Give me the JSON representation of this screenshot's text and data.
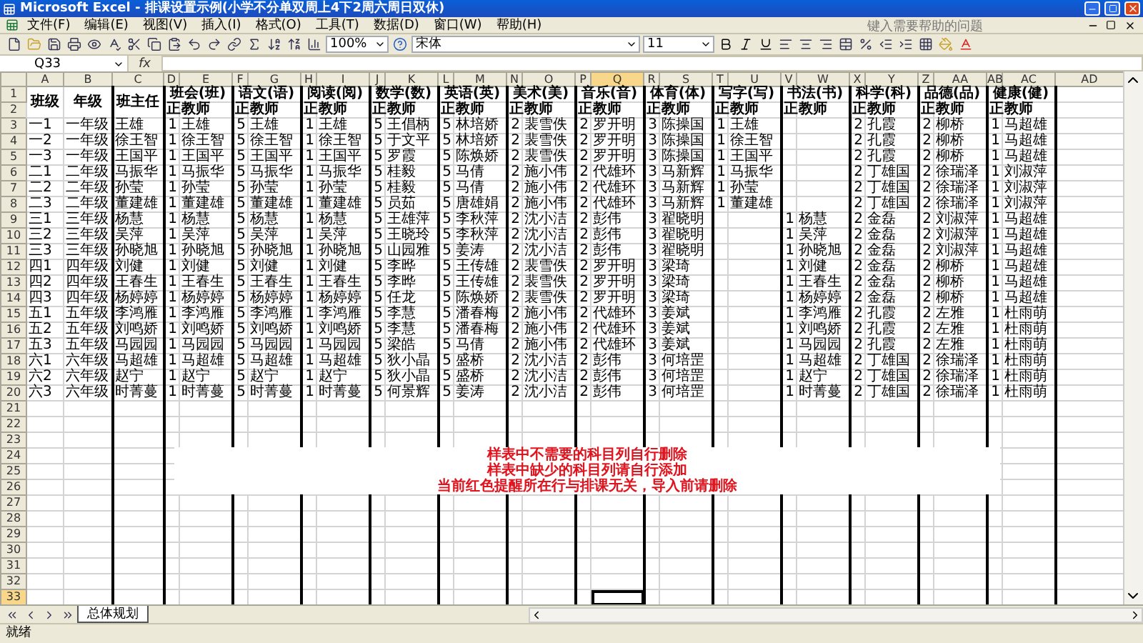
{
  "window": {
    "title": "Microsoft Excel - 排课设置示例(小学不分单双周上4下2周六周日双休)"
  },
  "menu": [
    "文件(F)",
    "编辑(E)",
    "视图(V)",
    "插入(I)",
    "格式(O)",
    "工具(T)",
    "数据(D)",
    "窗口(W)",
    "帮助(H)"
  ],
  "help_search": {
    "placeholder": "键入需要帮助的问题"
  },
  "toolbar": {
    "zoom": "100%",
    "font": "宋体",
    "size": "11"
  },
  "formula_bar": {
    "name_box": "Q33",
    "fx": "fx"
  },
  "column_headers": [
    {
      "label": "A",
      "selected": false
    },
    {
      "label": "B",
      "selected": false
    },
    {
      "label": "C",
      "selected": false
    },
    {
      "label": "D",
      "selected": false
    },
    {
      "label": "E",
      "selected": false
    },
    {
      "label": "F",
      "selected": false
    },
    {
      "label": "G",
      "selected": false
    },
    {
      "label": "H",
      "selected": false
    },
    {
      "label": "I",
      "selected": false
    },
    {
      "label": "J",
      "selected": false
    },
    {
      "label": "K",
      "selected": false
    },
    {
      "label": "L",
      "selected": false
    },
    {
      "label": "M",
      "selected": false
    },
    {
      "label": "N",
      "selected": false
    },
    {
      "label": "O",
      "selected": false
    },
    {
      "label": "P",
      "selected": false
    },
    {
      "label": "Q",
      "selected": true
    },
    {
      "label": "R",
      "selected": false
    },
    {
      "label": "S",
      "selected": false
    },
    {
      "label": "T",
      "selected": false
    },
    {
      "label": "U",
      "selected": false
    },
    {
      "label": "V",
      "selected": false
    },
    {
      "label": "W",
      "selected": false
    },
    {
      "label": "X",
      "selected": false
    },
    {
      "label": "Y",
      "selected": false
    },
    {
      "label": "Z",
      "selected": false
    },
    {
      "label": "AA",
      "selected": false
    },
    {
      "label": "AB",
      "selected": false
    },
    {
      "label": "AC",
      "selected": false
    },
    {
      "label": "AD",
      "selected": false
    }
  ],
  "row_numbers": [
    {
      "label": "1",
      "selected": false
    },
    {
      "label": "2",
      "selected": false
    },
    {
      "label": "3",
      "selected": false
    },
    {
      "label": "4",
      "selected": false
    },
    {
      "label": "5",
      "selected": false
    },
    {
      "label": "6",
      "selected": false
    },
    {
      "label": "7",
      "selected": false
    },
    {
      "label": "8",
      "selected": false
    },
    {
      "label": "9",
      "selected": false
    },
    {
      "label": "10",
      "selected": false
    },
    {
      "label": "11",
      "selected": false
    },
    {
      "label": "12",
      "selected": false
    },
    {
      "label": "13",
      "selected": false
    },
    {
      "label": "14",
      "selected": false
    },
    {
      "label": "15",
      "selected": false
    },
    {
      "label": "16",
      "selected": false
    },
    {
      "label": "17",
      "selected": false
    },
    {
      "label": "18",
      "selected": false
    },
    {
      "label": "19",
      "selected": false
    },
    {
      "label": "20",
      "selected": false
    },
    {
      "label": "21",
      "selected": false
    },
    {
      "label": "22",
      "selected": false
    },
    {
      "label": "23",
      "selected": false
    },
    {
      "label": "24",
      "selected": false
    },
    {
      "label": "25",
      "selected": false
    },
    {
      "label": "26",
      "selected": false
    },
    {
      "label": "27",
      "selected": false
    },
    {
      "label": "28",
      "selected": false
    },
    {
      "label": "29",
      "selected": false
    },
    {
      "label": "30",
      "selected": false
    },
    {
      "label": "31",
      "selected": false
    },
    {
      "label": "32",
      "selected": false
    },
    {
      "label": "33",
      "selected": true
    }
  ],
  "table": {
    "header_labels": [
      "班级",
      "年级",
      "班主任"
    ],
    "subjects": [
      {
        "name": "班会(班)",
        "count_label": "正",
        "teacher_label": "教师"
      },
      {
        "name": "语文(语)",
        "count_label": "正",
        "teacher_label": "教师"
      },
      {
        "name": "阅读(阅)",
        "count_label": "正",
        "teacher_label": "教师"
      },
      {
        "name": "数学(数)",
        "count_label": "正",
        "teacher_label": "教师"
      },
      {
        "name": "英语(英)",
        "count_label": "正",
        "teacher_label": "教师"
      },
      {
        "name": "美术(美)",
        "count_label": "正",
        "teacher_label": "教师"
      },
      {
        "name": "音乐(音)",
        "count_label": "正",
        "teacher_label": "教师"
      },
      {
        "name": "体育(体)",
        "count_label": "正",
        "teacher_label": "教师"
      },
      {
        "name": "写字(写)",
        "count_label": "正",
        "teacher_label": "教师"
      },
      {
        "name": "书法(书)",
        "count_label": "正",
        "teacher_label": "教师"
      },
      {
        "name": "科学(科)",
        "count_label": "正",
        "teacher_label": "教师"
      },
      {
        "name": "品德(品)",
        "count_label": "正",
        "teacher_label": "教师"
      },
      {
        "name": "健康(健)",
        "count_label": "正",
        "teacher_label": "教师"
      }
    ],
    "rows": [
      {
        "class": "一1",
        "grade": "一年级",
        "head": "王雄",
        "lessons": [
          {
            "kind": "lesson",
            "count": "1",
            "teacher": "王雄"
          },
          {
            "kind": "lesson",
            "count": "5",
            "teacher": "王雄"
          },
          {
            "kind": "lesson",
            "count": "1",
            "teacher": "王雄"
          },
          {
            "kind": "lesson",
            "count": "5",
            "teacher": "王倡柄"
          },
          {
            "kind": "lesson",
            "count": "5",
            "teacher": "林培娇"
          },
          {
            "kind": "lesson",
            "count": "2",
            "teacher": "裴雪佚"
          },
          {
            "kind": "lesson",
            "count": "2",
            "teacher": "罗开明"
          },
          {
            "kind": "lesson",
            "count": "3",
            "teacher": "陈操国"
          },
          {
            "kind": "lesson",
            "count": "1",
            "teacher": "王雄"
          },
          {
            "kind": "empty"
          },
          {
            "kind": "lesson",
            "count": "2",
            "teacher": "孔霞"
          },
          {
            "kind": "lesson",
            "count": "2",
            "teacher": "柳桥"
          },
          {
            "kind": "lesson",
            "count": "1",
            "teacher": "马超雄"
          }
        ]
      },
      {
        "class": "一2",
        "grade": "一年级",
        "head": "徐王智",
        "lessons": [
          {
            "kind": "lesson",
            "count": "1",
            "teacher": "徐王智"
          },
          {
            "kind": "lesson",
            "count": "5",
            "teacher": "徐王智"
          },
          {
            "kind": "lesson",
            "count": "1",
            "teacher": "徐王智"
          },
          {
            "kind": "lesson",
            "count": "5",
            "teacher": "于文平"
          },
          {
            "kind": "lesson",
            "count": "5",
            "teacher": "林培娇"
          },
          {
            "kind": "lesson",
            "count": "2",
            "teacher": "裴雪佚"
          },
          {
            "kind": "lesson",
            "count": "2",
            "teacher": "罗开明"
          },
          {
            "kind": "lesson",
            "count": "3",
            "teacher": "陈操国"
          },
          {
            "kind": "lesson",
            "count": "1",
            "teacher": "徐王智"
          },
          {
            "kind": "empty"
          },
          {
            "kind": "lesson",
            "count": "2",
            "teacher": "孔霞"
          },
          {
            "kind": "lesson",
            "count": "2",
            "teacher": "柳桥"
          },
          {
            "kind": "lesson",
            "count": "1",
            "teacher": "马超雄"
          }
        ]
      },
      {
        "class": "一3",
        "grade": "一年级",
        "head": "王国平",
        "lessons": [
          {
            "kind": "lesson",
            "count": "1",
            "teacher": "王国平"
          },
          {
            "kind": "lesson",
            "count": "5",
            "teacher": "王国平"
          },
          {
            "kind": "lesson",
            "count": "1",
            "teacher": "王国平"
          },
          {
            "kind": "lesson",
            "count": "5",
            "teacher": "罗霞"
          },
          {
            "kind": "lesson",
            "count": "5",
            "teacher": "陈焕娇"
          },
          {
            "kind": "lesson",
            "count": "2",
            "teacher": "裴雪佚"
          },
          {
            "kind": "lesson",
            "count": "2",
            "teacher": "罗开明"
          },
          {
            "kind": "lesson",
            "count": "3",
            "teacher": "陈操国"
          },
          {
            "kind": "lesson",
            "count": "1",
            "teacher": "王国平"
          },
          {
            "kind": "empty"
          },
          {
            "kind": "lesson",
            "count": "2",
            "teacher": "孔霞"
          },
          {
            "kind": "lesson",
            "count": "2",
            "teacher": "柳桥"
          },
          {
            "kind": "lesson",
            "count": "1",
            "teacher": "马超雄"
          }
        ]
      },
      {
        "class": "二1",
        "grade": "二年级",
        "head": "马振华",
        "lessons": [
          {
            "kind": "lesson",
            "count": "1",
            "teacher": "马振华"
          },
          {
            "kind": "lesson",
            "count": "5",
            "teacher": "马振华"
          },
          {
            "kind": "lesson",
            "count": "1",
            "teacher": "马振华"
          },
          {
            "kind": "lesson",
            "count": "5",
            "teacher": "桂毅"
          },
          {
            "kind": "lesson",
            "count": "5",
            "teacher": "马倩"
          },
          {
            "kind": "lesson",
            "count": "2",
            "teacher": "施小伟"
          },
          {
            "kind": "lesson",
            "count": "2",
            "teacher": "代雄环"
          },
          {
            "kind": "lesson",
            "count": "3",
            "teacher": "马新辉"
          },
          {
            "kind": "lesson",
            "count": "1",
            "teacher": "马振华"
          },
          {
            "kind": "empty"
          },
          {
            "kind": "lesson",
            "count": "2",
            "teacher": "丁雄国"
          },
          {
            "kind": "lesson",
            "count": "2",
            "teacher": "徐瑞泽"
          },
          {
            "kind": "lesson",
            "count": "1",
            "teacher": "刘淑萍"
          }
        ]
      },
      {
        "class": "二2",
        "grade": "二年级",
        "head": "孙莹",
        "lessons": [
          {
            "kind": "lesson",
            "count": "1",
            "teacher": "孙莹"
          },
          {
            "kind": "lesson",
            "count": "5",
            "teacher": "孙莹"
          },
          {
            "kind": "lesson",
            "count": "1",
            "teacher": "孙莹"
          },
          {
            "kind": "lesson",
            "count": "5",
            "teacher": "桂毅"
          },
          {
            "kind": "lesson",
            "count": "5",
            "teacher": "马倩"
          },
          {
            "kind": "lesson",
            "count": "2",
            "teacher": "施小伟"
          },
          {
            "kind": "lesson",
            "count": "2",
            "teacher": "代雄环"
          },
          {
            "kind": "lesson",
            "count": "3",
            "teacher": "马新辉"
          },
          {
            "kind": "lesson",
            "count": "1",
            "teacher": "孙莹"
          },
          {
            "kind": "empty"
          },
          {
            "kind": "lesson",
            "count": "2",
            "teacher": "丁雄国"
          },
          {
            "kind": "lesson",
            "count": "2",
            "teacher": "徐瑞泽"
          },
          {
            "kind": "lesson",
            "count": "1",
            "teacher": "刘淑萍"
          }
        ]
      },
      {
        "class": "二3",
        "grade": "二年级",
        "head": "董建雄",
        "lessons": [
          {
            "kind": "lesson",
            "count": "1",
            "teacher": "董建雄"
          },
          {
            "kind": "lesson",
            "count": "5",
            "teacher": "董建雄"
          },
          {
            "kind": "lesson",
            "count": "1",
            "teacher": "董建雄"
          },
          {
            "kind": "lesson",
            "count": "5",
            "teacher": "员茹"
          },
          {
            "kind": "lesson",
            "count": "5",
            "teacher": "唐雄娟"
          },
          {
            "kind": "lesson",
            "count": "2",
            "teacher": "施小伟"
          },
          {
            "kind": "lesson",
            "count": "2",
            "teacher": "代雄环"
          },
          {
            "kind": "lesson",
            "count": "3",
            "teacher": "马新辉"
          },
          {
            "kind": "lesson",
            "count": "1",
            "teacher": "董建雄"
          },
          {
            "kind": "empty"
          },
          {
            "kind": "lesson",
            "count": "2",
            "teacher": "丁雄国"
          },
          {
            "kind": "lesson",
            "count": "2",
            "teacher": "徐瑞泽"
          },
          {
            "kind": "lesson",
            "count": "1",
            "teacher": "刘淑萍"
          }
        ]
      },
      {
        "class": "三1",
        "grade": "三年级",
        "head": "杨慧",
        "lessons": [
          {
            "kind": "lesson",
            "count": "1",
            "teacher": "杨慧"
          },
          {
            "kind": "lesson",
            "count": "5",
            "teacher": "杨慧"
          },
          {
            "kind": "lesson",
            "count": "1",
            "teacher": "杨慧"
          },
          {
            "kind": "lesson",
            "count": "5",
            "teacher": "王雄萍"
          },
          {
            "kind": "lesson",
            "count": "5",
            "teacher": "李秋萍"
          },
          {
            "kind": "lesson",
            "count": "2",
            "teacher": "沈小洁"
          },
          {
            "kind": "lesson",
            "count": "2",
            "teacher": "彭伟"
          },
          {
            "kind": "lesson",
            "count": "3",
            "teacher": "翟晓明"
          },
          {
            "kind": "empty"
          },
          {
            "kind": "lesson",
            "count": "1",
            "teacher": "杨慧"
          },
          {
            "kind": "lesson",
            "count": "2",
            "teacher": "金磊"
          },
          {
            "kind": "lesson",
            "count": "2",
            "teacher": "刘淑萍"
          },
          {
            "kind": "lesson",
            "count": "1",
            "teacher": "马超雄"
          }
        ]
      },
      {
        "class": "三2",
        "grade": "三年级",
        "head": "吴萍",
        "lessons": [
          {
            "kind": "lesson",
            "count": "1",
            "teacher": "吴萍"
          },
          {
            "kind": "lesson",
            "count": "5",
            "teacher": "吴萍"
          },
          {
            "kind": "lesson",
            "count": "1",
            "teacher": "吴萍"
          },
          {
            "kind": "lesson",
            "count": "5",
            "teacher": "王晓玲"
          },
          {
            "kind": "lesson",
            "count": "5",
            "teacher": "李秋萍"
          },
          {
            "kind": "lesson",
            "count": "2",
            "teacher": "沈小洁"
          },
          {
            "kind": "lesson",
            "count": "2",
            "teacher": "彭伟"
          },
          {
            "kind": "lesson",
            "count": "3",
            "teacher": "翟晓明"
          },
          {
            "kind": "empty"
          },
          {
            "kind": "lesson",
            "count": "1",
            "teacher": "吴萍"
          },
          {
            "kind": "lesson",
            "count": "2",
            "teacher": "金磊"
          },
          {
            "kind": "lesson",
            "count": "2",
            "teacher": "刘淑萍"
          },
          {
            "kind": "lesson",
            "count": "1",
            "teacher": "马超雄"
          }
        ]
      },
      {
        "class": "三3",
        "grade": "三年级",
        "head": "孙晓旭",
        "lessons": [
          {
            "kind": "lesson",
            "count": "1",
            "teacher": "孙晓旭"
          },
          {
            "kind": "lesson",
            "count": "5",
            "teacher": "孙晓旭"
          },
          {
            "kind": "lesson",
            "count": "1",
            "teacher": "孙晓旭"
          },
          {
            "kind": "lesson",
            "count": "5",
            "teacher": "山园雅"
          },
          {
            "kind": "lesson",
            "count": "5",
            "teacher": "姜涛"
          },
          {
            "kind": "lesson",
            "count": "2",
            "teacher": "沈小洁"
          },
          {
            "kind": "lesson",
            "count": "2",
            "teacher": "彭伟"
          },
          {
            "kind": "lesson",
            "count": "3",
            "teacher": "翟晓明"
          },
          {
            "kind": "empty"
          },
          {
            "kind": "lesson",
            "count": "1",
            "teacher": "孙晓旭"
          },
          {
            "kind": "lesson",
            "count": "2",
            "teacher": "金磊"
          },
          {
            "kind": "lesson",
            "count": "2",
            "teacher": "刘淑萍"
          },
          {
            "kind": "lesson",
            "count": "1",
            "teacher": "马超雄"
          }
        ]
      },
      {
        "class": "四1",
        "grade": "四年级",
        "head": "刘健",
        "lessons": [
          {
            "kind": "lesson",
            "count": "1",
            "teacher": "刘健"
          },
          {
            "kind": "lesson",
            "count": "5",
            "teacher": "刘健"
          },
          {
            "kind": "lesson",
            "count": "1",
            "teacher": "刘健"
          },
          {
            "kind": "lesson",
            "count": "5",
            "teacher": "李晔"
          },
          {
            "kind": "lesson",
            "count": "5",
            "teacher": "王传雄"
          },
          {
            "kind": "lesson",
            "count": "2",
            "teacher": "裴雪佚"
          },
          {
            "kind": "lesson",
            "count": "2",
            "teacher": "罗开明"
          },
          {
            "kind": "lesson",
            "count": "3",
            "teacher": "梁琦"
          },
          {
            "kind": "empty"
          },
          {
            "kind": "lesson",
            "count": "1",
            "teacher": "刘健"
          },
          {
            "kind": "lesson",
            "count": "2",
            "teacher": "金磊"
          },
          {
            "kind": "lesson",
            "count": "2",
            "teacher": "柳桥"
          },
          {
            "kind": "lesson",
            "count": "1",
            "teacher": "马超雄"
          }
        ]
      },
      {
        "class": "四2",
        "grade": "四年级",
        "head": "王春生",
        "lessons": [
          {
            "kind": "lesson",
            "count": "1",
            "teacher": "王春生"
          },
          {
            "kind": "lesson",
            "count": "5",
            "teacher": "王春生"
          },
          {
            "kind": "lesson",
            "count": "1",
            "teacher": "王春生"
          },
          {
            "kind": "lesson",
            "count": "5",
            "teacher": "李晔"
          },
          {
            "kind": "lesson",
            "count": "5",
            "teacher": "王传雄"
          },
          {
            "kind": "lesson",
            "count": "2",
            "teacher": "裴雪佚"
          },
          {
            "kind": "lesson",
            "count": "2",
            "teacher": "罗开明"
          },
          {
            "kind": "lesson",
            "count": "3",
            "teacher": "梁琦"
          },
          {
            "kind": "empty"
          },
          {
            "kind": "lesson",
            "count": "1",
            "teacher": "王春生"
          },
          {
            "kind": "lesson",
            "count": "2",
            "teacher": "金磊"
          },
          {
            "kind": "lesson",
            "count": "2",
            "teacher": "柳桥"
          },
          {
            "kind": "lesson",
            "count": "1",
            "teacher": "马超雄"
          }
        ]
      },
      {
        "class": "四3",
        "grade": "四年级",
        "head": "杨婷婷",
        "lessons": [
          {
            "kind": "lesson",
            "count": "1",
            "teacher": "杨婷婷"
          },
          {
            "kind": "lesson",
            "count": "5",
            "teacher": "杨婷婷"
          },
          {
            "kind": "lesson",
            "count": "1",
            "teacher": "杨婷婷"
          },
          {
            "kind": "lesson",
            "count": "5",
            "teacher": "任龙"
          },
          {
            "kind": "lesson",
            "count": "5",
            "teacher": "陈焕娇"
          },
          {
            "kind": "lesson",
            "count": "2",
            "teacher": "裴雪佚"
          },
          {
            "kind": "lesson",
            "count": "2",
            "teacher": "罗开明"
          },
          {
            "kind": "lesson",
            "count": "3",
            "teacher": "梁琦"
          },
          {
            "kind": "empty"
          },
          {
            "kind": "lesson",
            "count": "1",
            "teacher": "杨婷婷"
          },
          {
            "kind": "lesson",
            "count": "2",
            "teacher": "金磊"
          },
          {
            "kind": "lesson",
            "count": "2",
            "teacher": "柳桥"
          },
          {
            "kind": "lesson",
            "count": "1",
            "teacher": "马超雄"
          }
        ]
      },
      {
        "class": "五1",
        "grade": "五年级",
        "head": "李鸿雁",
        "lessons": [
          {
            "kind": "lesson",
            "count": "1",
            "teacher": "李鸿雁"
          },
          {
            "kind": "lesson",
            "count": "5",
            "teacher": "李鸿雁"
          },
          {
            "kind": "lesson",
            "count": "1",
            "teacher": "李鸿雁"
          },
          {
            "kind": "lesson",
            "count": "5",
            "teacher": "李慧"
          },
          {
            "kind": "lesson",
            "count": "5",
            "teacher": "潘春梅"
          },
          {
            "kind": "lesson",
            "count": "2",
            "teacher": "施小伟"
          },
          {
            "kind": "lesson",
            "count": "2",
            "teacher": "代雄环"
          },
          {
            "kind": "lesson",
            "count": "3",
            "teacher": "姜斌"
          },
          {
            "kind": "empty"
          },
          {
            "kind": "lesson",
            "count": "1",
            "teacher": "李鸿雁"
          },
          {
            "kind": "lesson",
            "count": "2",
            "teacher": "孔霞"
          },
          {
            "kind": "lesson",
            "count": "2",
            "teacher": "左雅"
          },
          {
            "kind": "lesson",
            "count": "1",
            "teacher": "杜雨萌"
          }
        ]
      },
      {
        "class": "五2",
        "grade": "五年级",
        "head": "刘鸣娇",
        "lessons": [
          {
            "kind": "lesson",
            "count": "1",
            "teacher": "刘鸣娇"
          },
          {
            "kind": "lesson",
            "count": "5",
            "teacher": "刘鸣娇"
          },
          {
            "kind": "lesson",
            "count": "1",
            "teacher": "刘鸣娇"
          },
          {
            "kind": "lesson",
            "count": "5",
            "teacher": "李慧"
          },
          {
            "kind": "lesson",
            "count": "5",
            "teacher": "潘春梅"
          },
          {
            "kind": "lesson",
            "count": "2",
            "teacher": "施小伟"
          },
          {
            "kind": "lesson",
            "count": "2",
            "teacher": "代雄环"
          },
          {
            "kind": "lesson",
            "count": "3",
            "teacher": "姜斌"
          },
          {
            "kind": "empty"
          },
          {
            "kind": "lesson",
            "count": "1",
            "teacher": "刘鸣娇"
          },
          {
            "kind": "lesson",
            "count": "2",
            "teacher": "孔霞"
          },
          {
            "kind": "lesson",
            "count": "2",
            "teacher": "左雅"
          },
          {
            "kind": "lesson",
            "count": "1",
            "teacher": "杜雨萌"
          }
        ]
      },
      {
        "class": "五3",
        "grade": "五年级",
        "head": "马园园",
        "lessons": [
          {
            "kind": "lesson",
            "count": "1",
            "teacher": "马园园"
          },
          {
            "kind": "lesson",
            "count": "5",
            "teacher": "马园园"
          },
          {
            "kind": "lesson",
            "count": "1",
            "teacher": "马园园"
          },
          {
            "kind": "lesson",
            "count": "5",
            "teacher": "梁皓"
          },
          {
            "kind": "lesson",
            "count": "5",
            "teacher": "马倩"
          },
          {
            "kind": "lesson",
            "count": "2",
            "teacher": "施小伟"
          },
          {
            "kind": "lesson",
            "count": "2",
            "teacher": "代雄环"
          },
          {
            "kind": "lesson",
            "count": "3",
            "teacher": "姜斌"
          },
          {
            "kind": "empty"
          },
          {
            "kind": "lesson",
            "count": "1",
            "teacher": "马园园"
          },
          {
            "kind": "lesson",
            "count": "2",
            "teacher": "孔霞"
          },
          {
            "kind": "lesson",
            "count": "2",
            "teacher": "左雅"
          },
          {
            "kind": "lesson",
            "count": "1",
            "teacher": "杜雨萌"
          }
        ]
      },
      {
        "class": "六1",
        "grade": "六年级",
        "head": "马超雄",
        "lessons": [
          {
            "kind": "lesson",
            "count": "1",
            "teacher": "马超雄"
          },
          {
            "kind": "lesson",
            "count": "5",
            "teacher": "马超雄"
          },
          {
            "kind": "lesson",
            "count": "1",
            "teacher": "马超雄"
          },
          {
            "kind": "lesson",
            "count": "5",
            "teacher": "狄小晶"
          },
          {
            "kind": "lesson",
            "count": "5",
            "teacher": "盛桥"
          },
          {
            "kind": "lesson",
            "count": "2",
            "teacher": "沈小洁"
          },
          {
            "kind": "lesson",
            "count": "2",
            "teacher": "彭伟"
          },
          {
            "kind": "lesson",
            "count": "3",
            "teacher": "何培罡"
          },
          {
            "kind": "empty"
          },
          {
            "kind": "lesson",
            "count": "1",
            "teacher": "马超雄"
          },
          {
            "kind": "lesson",
            "count": "2",
            "teacher": "丁雄国"
          },
          {
            "kind": "lesson",
            "count": "2",
            "teacher": "徐瑞泽"
          },
          {
            "kind": "lesson",
            "count": "1",
            "teacher": "杜雨萌"
          }
        ]
      },
      {
        "class": "六2",
        "grade": "六年级",
        "head": "赵宁",
        "lessons": [
          {
            "kind": "lesson",
            "count": "1",
            "teacher": "赵宁"
          },
          {
            "kind": "lesson",
            "count": "5",
            "teacher": "赵宁"
          },
          {
            "kind": "lesson",
            "count": "1",
            "teacher": "赵宁"
          },
          {
            "kind": "lesson",
            "count": "5",
            "teacher": "狄小晶"
          },
          {
            "kind": "lesson",
            "count": "5",
            "teacher": "盛桥"
          },
          {
            "kind": "lesson",
            "count": "2",
            "teacher": "沈小洁"
          },
          {
            "kind": "lesson",
            "count": "2",
            "teacher": "彭伟"
          },
          {
            "kind": "lesson",
            "count": "3",
            "teacher": "何培罡"
          },
          {
            "kind": "empty"
          },
          {
            "kind": "lesson",
            "count": "1",
            "teacher": "赵宁"
          },
          {
            "kind": "lesson",
            "count": "2",
            "teacher": "丁雄国"
          },
          {
            "kind": "lesson",
            "count": "2",
            "teacher": "徐瑞泽"
          },
          {
            "kind": "lesson",
            "count": "1",
            "teacher": "杜雨萌"
          }
        ]
      },
      {
        "class": "六3",
        "grade": "六年级",
        "head": "时菁蔓",
        "lessons": [
          {
            "kind": "lesson",
            "count": "1",
            "teacher": "时菁蔓"
          },
          {
            "kind": "lesson",
            "count": "5",
            "teacher": "时菁蔓"
          },
          {
            "kind": "lesson",
            "count": "1",
            "teacher": "时菁蔓"
          },
          {
            "kind": "lesson",
            "count": "5",
            "teacher": "何景辉"
          },
          {
            "kind": "lesson",
            "count": "5",
            "teacher": "姜涛"
          },
          {
            "kind": "lesson",
            "count": "2",
            "teacher": "沈小洁"
          },
          {
            "kind": "lesson",
            "count": "2",
            "teacher": "彭伟"
          },
          {
            "kind": "lesson",
            "count": "3",
            "teacher": "何培罡"
          },
          {
            "kind": "empty"
          },
          {
            "kind": "lesson",
            "count": "1",
            "teacher": "时菁蔓"
          },
          {
            "kind": "lesson",
            "count": "2",
            "teacher": "丁雄国"
          },
          {
            "kind": "lesson",
            "count": "2",
            "teacher": "徐瑞泽"
          },
          {
            "kind": "lesson",
            "count": "1",
            "teacher": "杜雨萌"
          }
        ]
      }
    ]
  },
  "note": {
    "lines": [
      "样表中不需要的科目列自行删除",
      "样表中缺少的科目列请自行添加",
      "当前红色提醒所在行与排课无关，导入前请删除"
    ]
  },
  "sheet_tabs": [
    {
      "label": "总体规划",
      "selected": true
    }
  ],
  "status_bar": {
    "text": "就绪"
  }
}
